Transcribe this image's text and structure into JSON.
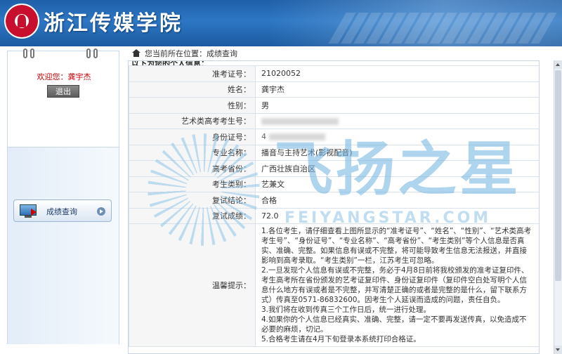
{
  "header": {
    "school_name": "浙江传媒学院"
  },
  "sidebar": {
    "welcome_text": "欢迎您：龚宇杰",
    "logout_label": "退出",
    "menu": [
      {
        "label": "成绩查询"
      }
    ]
  },
  "breadcrumb": {
    "text": "您当前所在位置：成绩查询"
  },
  "section_title": "以下为您的个人信息：",
  "info_rows": [
    {
      "label": "准考证号：",
      "value": "21020052"
    },
    {
      "label": "姓名：",
      "value": "龚宇杰"
    },
    {
      "label": "性别：",
      "value": "男"
    },
    {
      "label": "艺术类高考考生号：",
      "value": ""
    },
    {
      "label": "身份证号：",
      "value": "4"
    },
    {
      "label": "专业名称：",
      "value": "播音与主持艺术(影视配音)"
    },
    {
      "label": "高考省份：",
      "value": "广西壮族自治区"
    },
    {
      "label": "考生类别：",
      "value": "艺兼文"
    },
    {
      "label": "复试结论：",
      "value": "合格"
    },
    {
      "label": "复试成绩：",
      "value": "72.0"
    }
  ],
  "tips": {
    "label": "温馨提示：",
    "lines": [
      "1.各位考生，请仔细查看上图所显示的“准考证号”、“姓名”、“性别”、“艺术类高考考生号”、“身份证号”、“专业名称”、“高考省份”、“考生类别”等个人信息是否真实、准确、完整。如果信息有误或不完整，将可能导致考生信息无法报送，并直接影响到高考录取。“考生类别”一栏，江苏考生可忽略。",
      "2.一旦发现个人信息有误或不完整，务必于4月8日前将我校颁发的准考证复印件、考生高考所在省份颁发的艺考证复印件、身份证复印件（复印件空白处写明个人信息什么地方有误或者是不完整，并写清楚正确的或者是完整的是什么，留下联系方式）传真至0571-86832600。因考生个人延误而造成的问题，责任自负。",
      "3.我们将在收到传真三个工作日后，统一进行处理。",
      "4.如果你的个人信息已经真实、准确、完整，请一定不要再发送传真，以免造成不必要的麻烦，切记。",
      "5.合格考生请在4月下旬登录本系统打印合格证。"
    ]
  },
  "watermark": {
    "text": "飞扬之星",
    "sub": "FEIYANGSTAR.COM"
  },
  "colors": {
    "header_blue": "#1f5fa8",
    "welcome_red": "#cc0000",
    "label_bg": "#f6f6f6"
  }
}
